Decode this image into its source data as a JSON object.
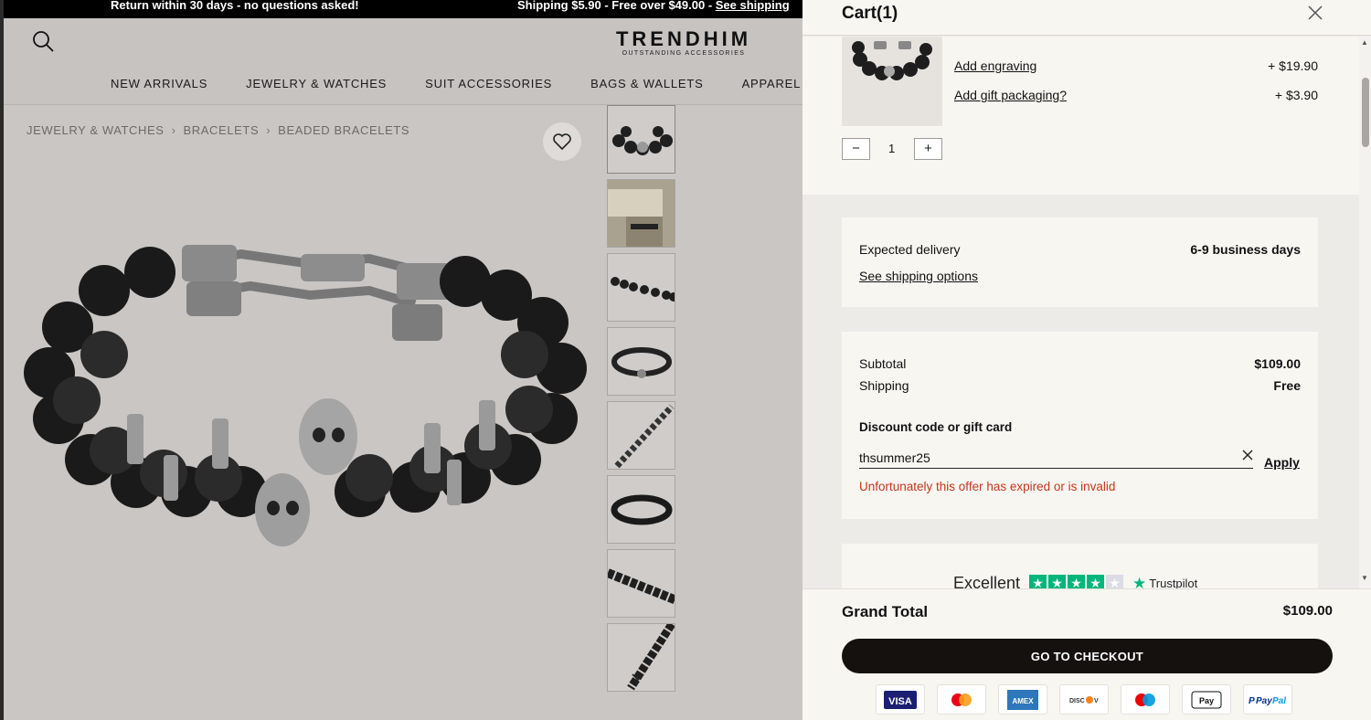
{
  "promo_bar": {
    "message_returns": "Return within 30 days - no questions asked!",
    "message_shipping": "Shipping $5.90 - Free over $49.00 - ",
    "shipping_link": "See shipping"
  },
  "header": {
    "logo_name": "TRENDHIM",
    "logo_tagline": "OUTSTANDING ACCESSORIES",
    "nav": [
      "NEW ARRIVALS",
      "JEWELRY & WATCHES",
      "SUIT ACCESSORIES",
      "BAGS & WALLETS",
      "APPAREL &"
    ]
  },
  "breadcrumb": [
    "JEWELRY & WATCHES",
    "BRACELETS",
    "BEADED BRACELETS"
  ],
  "cart": {
    "title": "Cart(1)",
    "addons": [
      {
        "label": "Add engraving",
        "price": "+ $19.90"
      },
      {
        "label": "Add gift packaging?",
        "price": "+ $3.90"
      }
    ],
    "quantity": "1",
    "qty_minus": "−",
    "qty_plus": "+",
    "delivery": {
      "label": "Expected delivery",
      "value": "6-9 business days",
      "link": "See shipping options"
    },
    "summary": {
      "subtotal_label": "Subtotal",
      "subtotal_value": "$109.00",
      "shipping_label": "Shipping",
      "shipping_value": "Free"
    },
    "discount": {
      "label": "Discount code or gift card",
      "value": "thsummer25",
      "apply_label": "Apply",
      "error": "Unfortunately this offer has expired or is invalid"
    },
    "trustpilot": {
      "rating_word": "Excellent",
      "brand": "Trustpilot"
    },
    "grand_total_label": "Grand Total",
    "grand_total_value": "$109.00",
    "checkout_label": "GO TO CHECKOUT",
    "payment_methods": [
      "VISA",
      "Mastercard",
      "AMEX",
      "Discover",
      "Maestro",
      "Apple Pay",
      "PayPal"
    ]
  },
  "colors": {
    "error": "#c2371f",
    "trustpilot_green": "#00b67a",
    "checkout_button": "#15110f"
  }
}
